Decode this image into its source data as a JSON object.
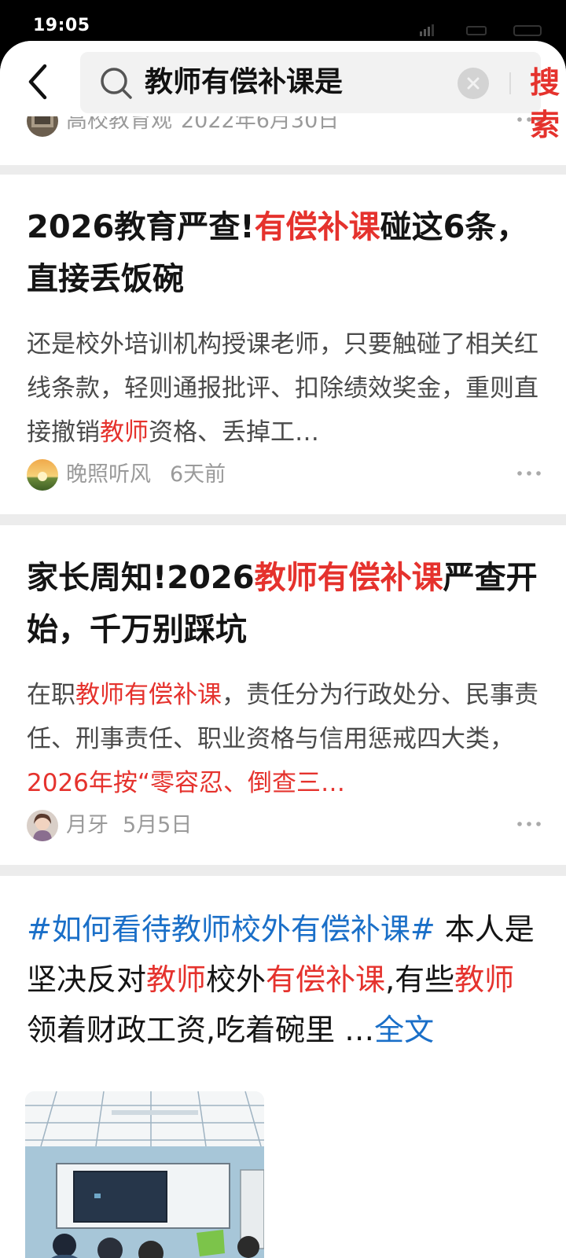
{
  "status_bar": {
    "time": "19:05"
  },
  "search": {
    "query": "教师有偿补课是",
    "submit_label": "搜索"
  },
  "results": [
    {
      "author": "高校教育观",
      "date": "2022年6月30日"
    },
    {
      "title_parts": [
        "2026教育严查!",
        "有偿补课",
        "碰这6条，直接丢饭碗"
      ],
      "summary_parts": [
        "还是校外培训机构授课老师，只要触碰了相关红线条款，轻则通报批评、扣除绩效奖金，重则直接撤销",
        "教师",
        "资格、丢掉工…"
      ],
      "author": "晚照听风",
      "date": "6天前"
    },
    {
      "title_parts": [
        "家长周知!2026",
        "教师有偿补课",
        "严查开始，千万别踩坑"
      ],
      "summary_parts": [
        "在职",
        "教师有偿补课",
        "，责任分为行政处分、民事责任、刑事责任、职业资格与信用惩戒四大类，",
        "2026年按“零容忍、倒查三…"
      ],
      "author": "月牙",
      "date": "5月5日"
    },
    {
      "post_parts": [
        "#如何看待教师校外有偿补课#",
        " 本人是坚决反对",
        "教师",
        "校外",
        "有偿补课",
        ",有些",
        "教师",
        "领着财政工资,吃着碗里  …"
      ],
      "read_more": "全文"
    }
  ],
  "colors": {
    "highlight": "#e5322d",
    "link": "#1a6fc8"
  }
}
